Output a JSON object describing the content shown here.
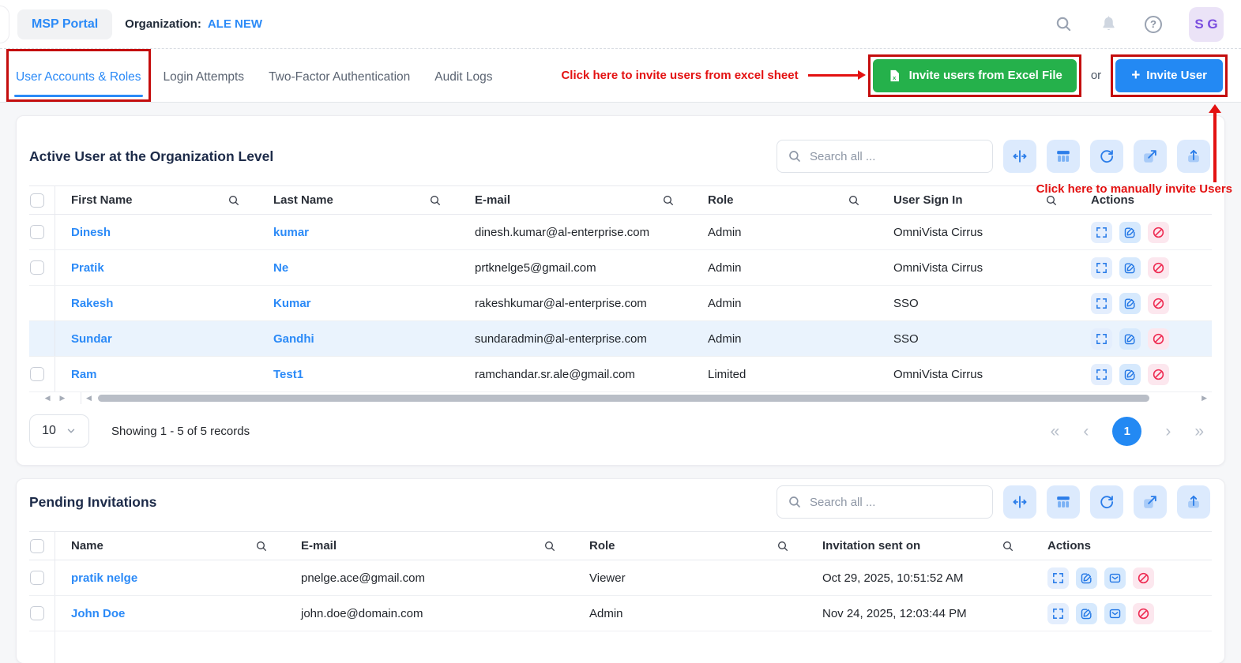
{
  "topbar": {
    "app_title": "MSP Portal",
    "org_label": "Organization:",
    "org_value": "ALE NEW",
    "avatar": "S G"
  },
  "tabs": {
    "items": [
      {
        "label": "User Accounts & Roles"
      },
      {
        "label": "Login Attempts"
      },
      {
        "label": "Two-Factor Authentication"
      },
      {
        "label": "Audit Logs"
      }
    ]
  },
  "invite": {
    "excel_annotation": "Click here to invite users from excel sheet",
    "excel_button_label": "Invite users from Excel File",
    "or_label": "or",
    "invite_button_label": "Invite User",
    "manual_annotation": "Click here to manually invite Users"
  },
  "active_users": {
    "title": "Active User at the Organization Level",
    "search_placeholder": "Search all ...",
    "columns": {
      "first_name": "First Name",
      "last_name": "Last Name",
      "email": "E-mail",
      "role": "Role",
      "sign_in": "User Sign In",
      "actions": "Actions"
    },
    "rows": [
      {
        "first_name": "Dinesh",
        "last_name": "kumar",
        "email": "dinesh.kumar@al-enterprise.com",
        "role": "Admin",
        "sign_in": "OmniVista Cirrus"
      },
      {
        "first_name": "Pratik",
        "last_name": "Ne",
        "email": "prtknelge5@gmail.com",
        "role": "Admin",
        "sign_in": "OmniVista Cirrus"
      },
      {
        "first_name": "Rakesh",
        "last_name": "Kumar",
        "email": "rakeshkumar@al-enterprise.com",
        "role": "Admin",
        "sign_in": "SSO"
      },
      {
        "first_name": "Sundar",
        "last_name": "Gandhi",
        "email": "sundaradmin@al-enterprise.com",
        "role": "Admin",
        "sign_in": "SSO"
      },
      {
        "first_name": "Ram",
        "last_name": "Test1",
        "email": "ramchandar.sr.ale@gmail.com",
        "role": "Limited",
        "sign_in": "OmniVista Cirrus"
      }
    ],
    "pagination": {
      "page_size": "10",
      "showing": "Showing 1 - 5 of 5 records",
      "current_page": "1"
    }
  },
  "pending_invitations": {
    "title": "Pending Invitations",
    "search_placeholder": "Search all ...",
    "columns": {
      "name": "Name",
      "email": "E-mail",
      "role": "Role",
      "sent_on": "Invitation sent on",
      "actions": "Actions"
    },
    "rows": [
      {
        "name": "pratik nelge",
        "email": "pnelge.ace@gmail.com",
        "role": "Viewer",
        "sent_on": "Oct 29, 2025, 10:51:52 AM"
      },
      {
        "name": "John Doe",
        "email": "john.doe@domain.com",
        "role": "Admin",
        "sent_on": "Nov 24, 2025, 12:03:44 PM"
      }
    ]
  },
  "icons": {
    "search": "magnifier",
    "bell": "notifications",
    "help": "question-circle",
    "excel": "excel-file",
    "plus": "+",
    "fit_columns": "arrows-left-right",
    "columns": "column-chooser",
    "refresh": "circular-arrow",
    "export": "arrow-up-right",
    "upload": "arrow-up-tray",
    "expand_row": "fullscreen-brackets",
    "edit": "pencil-square",
    "resend_mail": "envelope",
    "block": "circle-slash"
  },
  "colors": {
    "link_blue": "#2b8af7",
    "button_green": "#25b14b",
    "annotation_red": "#e31111",
    "danger_red": "#ee2950",
    "avatar_purple": "#7a4ddf",
    "row_highlight": "#eaf3fd"
  }
}
